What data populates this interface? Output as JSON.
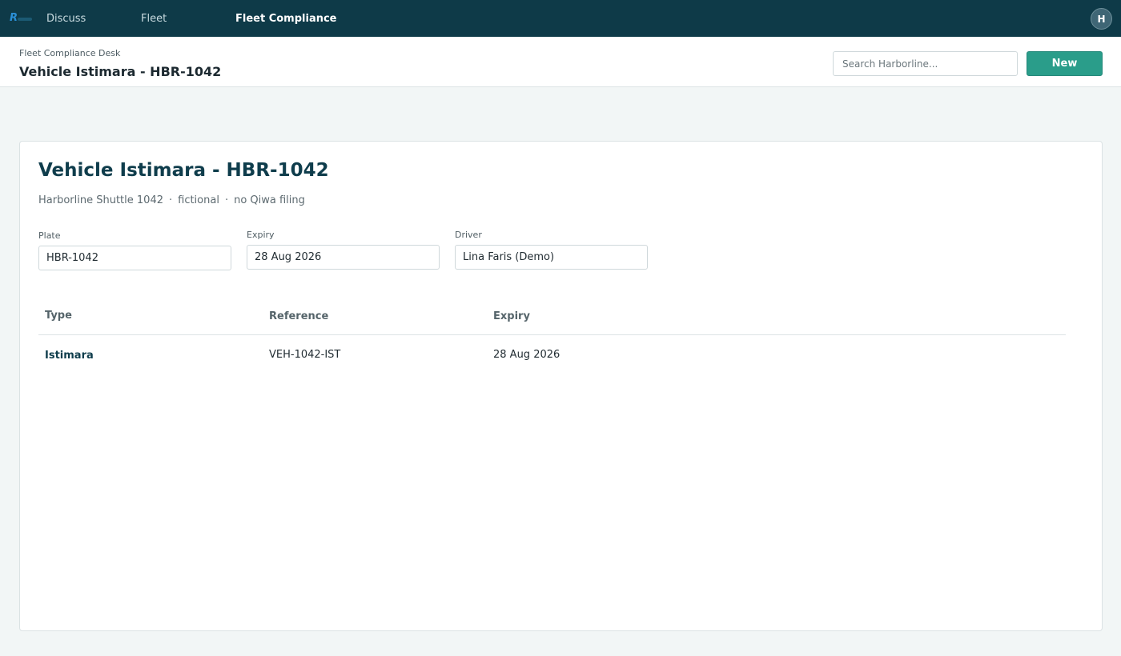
{
  "nav": {
    "items": [
      {
        "label": "Discuss"
      },
      {
        "label": "Fleet"
      },
      {
        "label": "Fleet Compliance"
      }
    ],
    "avatar_initial": "H"
  },
  "header": {
    "breadcrumb": "Fleet Compliance Desk",
    "title": "Vehicle Istimara - HBR-1042",
    "search_placeholder": "Search Harborline...",
    "new_label": "New"
  },
  "record": {
    "heading": "Vehicle Istimara - HBR-1042",
    "meta": [
      "Harborline Shuttle 1042",
      "fictional",
      "no Qiwa filing"
    ],
    "meta_separator": "·",
    "fields": {
      "plate": {
        "label": "Plate",
        "value": "HBR-1042"
      },
      "expiry": {
        "label": "Expiry",
        "value": "28 Aug 2026"
      },
      "driver": {
        "label": "Driver",
        "value": "Lina Faris (Demo)"
      }
    },
    "table": {
      "columns": [
        "Type",
        "Reference",
        "Expiry"
      ],
      "rows": [
        {
          "type": "Istimara",
          "reference": "VEH-1042-IST",
          "expiry": "28 Aug 2026"
        }
      ]
    }
  },
  "colors": {
    "nav_bg": "#0e3a48",
    "accent": "#2a9d8a",
    "heading": "#0f3d4c"
  }
}
